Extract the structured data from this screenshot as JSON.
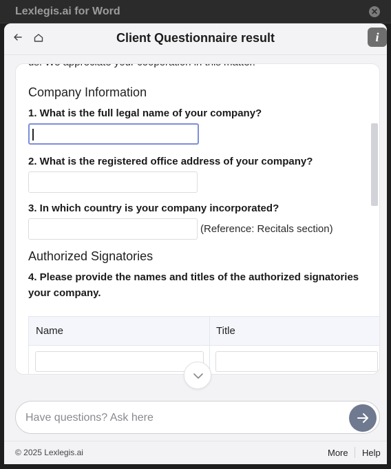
{
  "window": {
    "app_title": "Lexlegis.ai for Word",
    "close_icon": "close-circle-icon"
  },
  "header": {
    "title": "Client Questionnaire result",
    "back_icon": "arrow-left-icon",
    "home_icon": "home-icon",
    "info_label": "i"
  },
  "document": {
    "intro_tail": "us. We appreciate your cooperation in this matter.",
    "sections": [
      {
        "title": "Company Information",
        "questions": [
          {
            "text": "1. What is the full legal name of your company?",
            "value": ""
          },
          {
            "text": "2. What is the registered office address of your company?",
            "value": ""
          },
          {
            "text": "3. In which country is your company incorporated?",
            "value": "",
            "reference": "(Reference: Recitals section)"
          }
        ]
      },
      {
        "title": "Authorized Signatories",
        "questions": [
          {
            "text": "4. Please provide the names and titles of the authorized signatories your company."
          }
        ],
        "table": {
          "columns": [
            "Name",
            "Title"
          ]
        }
      }
    ],
    "scroll_down_icon": "chevron-down-icon"
  },
  "composer": {
    "placeholder": "Have questions? Ask here",
    "send_icon": "arrow-right-icon"
  },
  "footer": {
    "copyright": "© 2025 Lexlegis.ai",
    "more": "More",
    "help": "Help"
  },
  "colors": {
    "accent_focus": "#7d8ed8",
    "send_button": "#6f7a90",
    "info_button": "#6e6e6e"
  }
}
